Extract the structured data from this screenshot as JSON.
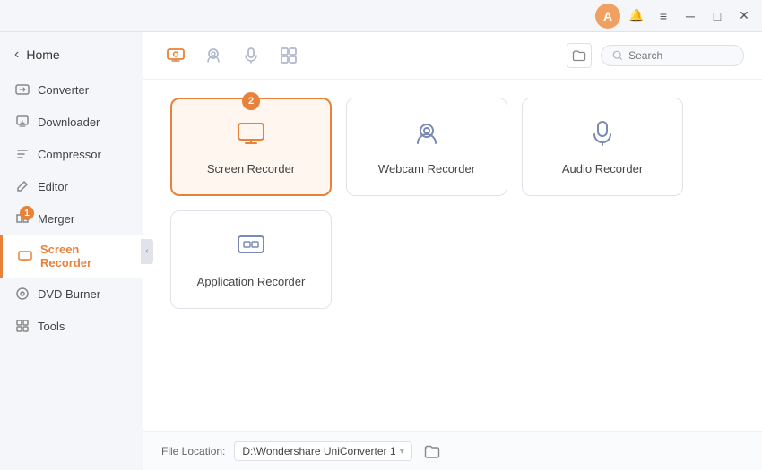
{
  "titleBar": {
    "userInitial": "A",
    "buttons": {
      "notification": "🔔",
      "menu": "≡",
      "minimize": "─",
      "maximize": "□",
      "close": "✕"
    }
  },
  "sidebar": {
    "homeLabel": "Home",
    "items": [
      {
        "id": "converter",
        "label": "Converter",
        "active": false
      },
      {
        "id": "downloader",
        "label": "Downloader",
        "active": false
      },
      {
        "id": "compressor",
        "label": "Compressor",
        "active": false
      },
      {
        "id": "editor",
        "label": "Editor",
        "active": false
      },
      {
        "id": "merger",
        "label": "Merger",
        "active": false,
        "badge": "1"
      },
      {
        "id": "screen-recorder",
        "label": "Screen Recorder",
        "active": true
      },
      {
        "id": "dvd-burner",
        "label": "DVD Burner",
        "active": false
      },
      {
        "id": "tools",
        "label": "Tools",
        "active": false
      }
    ]
  },
  "toolbar": {
    "searchPlaceholder": "Search"
  },
  "recorderCards": [
    {
      "id": "screen-recorder",
      "label": "Screen Recorder",
      "active": true,
      "badge": "2"
    },
    {
      "id": "webcam-recorder",
      "label": "Webcam Recorder",
      "active": false
    },
    {
      "id": "audio-recorder",
      "label": "Audio Recorder",
      "active": false
    },
    {
      "id": "application-recorder",
      "label": "Application Recorder",
      "active": false
    }
  ],
  "bottomBar": {
    "fileLocationLabel": "File Location:",
    "fileLocationValue": "D:\\Wondershare UniConverter 1",
    "dropdownArrow": "▾"
  }
}
